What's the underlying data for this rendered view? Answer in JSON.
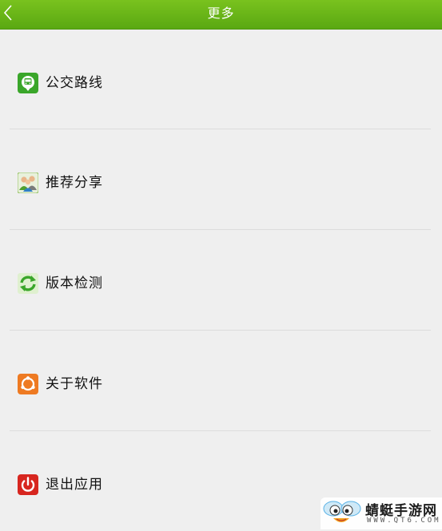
{
  "header": {
    "title": "更多",
    "back_icon": "chevron-left-icon",
    "bg_color": "#6cb818"
  },
  "menu": {
    "items": [
      {
        "label": "公交路线",
        "icon": "bus-icon",
        "color": "#3aa62a"
      },
      {
        "label": "推荐分享",
        "icon": "people-icon",
        "color": "#5b9a2e"
      },
      {
        "label": "版本检测",
        "icon": "refresh-icon",
        "color": "#3aa62a"
      },
      {
        "label": "关于软件",
        "icon": "info-ring-icon",
        "color": "#ee7a22"
      },
      {
        "label": "退出应用",
        "icon": "power-icon",
        "color": "#d7261f"
      }
    ]
  },
  "watermark": {
    "name": "蜻蜓手游网",
    "url": "WWW.QT6.COM"
  }
}
